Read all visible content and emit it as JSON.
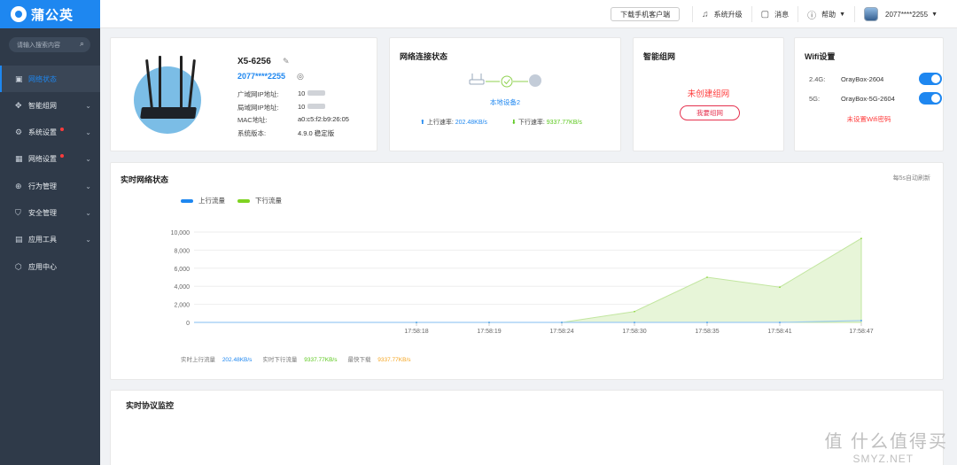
{
  "app": {
    "name": "蒲公英"
  },
  "topbar": {
    "download_client": "下载手机客户端",
    "upgrade": "系统升级",
    "messages": "消息",
    "help": "帮助",
    "user_id": "2077****2255"
  },
  "sidebar": {
    "search_placeholder": "请输入搜索内容",
    "items": [
      {
        "label": "网络状态",
        "icon": "monitor-icon",
        "active": true,
        "has_chevron": false,
        "dot": false
      },
      {
        "label": "智能组网",
        "icon": "network-icon",
        "active": false,
        "has_chevron": true,
        "dot": false
      },
      {
        "label": "系统设置",
        "icon": "gear-icon",
        "active": false,
        "has_chevron": true,
        "dot": true
      },
      {
        "label": "网络设置",
        "icon": "grid-icon",
        "active": false,
        "has_chevron": true,
        "dot": true
      },
      {
        "label": "行为管理",
        "icon": "behavior-icon",
        "active": false,
        "has_chevron": true,
        "dot": false
      },
      {
        "label": "安全管理",
        "icon": "shield-icon",
        "active": false,
        "has_chevron": true,
        "dot": false
      },
      {
        "label": "应用工具",
        "icon": "toolbox-icon",
        "active": false,
        "has_chevron": true,
        "dot": false
      },
      {
        "label": "应用中心",
        "icon": "cube-icon",
        "active": false,
        "has_chevron": false,
        "dot": false
      }
    ]
  },
  "device": {
    "model": "X5-6256",
    "id": "2077****2255",
    "rows": [
      {
        "label": "广域网IP地址:",
        "value": "10"
      },
      {
        "label": "局域网IP地址:",
        "value": "10"
      },
      {
        "label": "MAC地址:",
        "value": "a0:c5:f2:b9:26:05"
      },
      {
        "label": "系统版本:",
        "value": "4.9.0 稳定版"
      }
    ]
  },
  "network_status": {
    "title": "网络连接状态",
    "device_label": "本地设备2",
    "up_label": "上行速率:",
    "up_value": "202.48KB/s",
    "down_label": "下行速率:",
    "down_value": "9337.77KB/s"
  },
  "smart_network": {
    "title": "智能组网",
    "status": "未创建组网",
    "button": "我要组网"
  },
  "wifi": {
    "title": "Wifi设置",
    "bands": [
      {
        "band": "2.4G:",
        "ssid": "OrayBox-2604",
        "enabled": true
      },
      {
        "band": "5G:",
        "ssid": "OrayBox-5G-2604",
        "enabled": true
      }
    ],
    "warning": "未设置Wifi密码"
  },
  "realtime": {
    "title": "实时网络状态",
    "refresh_note": "每5s自动刷新",
    "stats": {
      "up_label": "实时上行流量",
      "up_value": "202.48KB/s",
      "down_label": "实时下行流量",
      "down_value": "9337.77KB/s",
      "peak_label": "最快下载",
      "peak_value": "9337.77KB/s"
    }
  },
  "protocol": {
    "title": "实时协议监控"
  },
  "watermark": {
    "main": "值 什么值得买",
    "sub": "SMYZ.NET"
  },
  "colors": {
    "accent": "#1e87f0",
    "download": "#7ed321",
    "alert": "#ff3b3b",
    "peak": "#f5a623"
  },
  "chart_data": {
    "type": "area",
    "x": [
      "17:58:18",
      "17:58:19",
      "17:58:24",
      "17:58:30",
      "17:58:35",
      "17:58:41",
      "17:58:47"
    ],
    "series": [
      {
        "name": "上行流量",
        "color": "#1e87f0",
        "values": [
          0,
          0,
          0,
          0,
          0,
          0,
          200
        ]
      },
      {
        "name": "下行流量",
        "color": "#7ed321",
        "values": [
          0,
          0,
          0,
          1200,
          5000,
          3900,
          9300
        ]
      }
    ],
    "ylim": [
      0,
      10000
    ],
    "yticks": [
      "10,000",
      "8,000",
      "6,000",
      "4,000",
      "2,000",
      "0"
    ],
    "ytick_values": [
      10000,
      8000,
      6000,
      4000,
      2000,
      0
    ],
    "grid": true,
    "legend": "top-left"
  }
}
